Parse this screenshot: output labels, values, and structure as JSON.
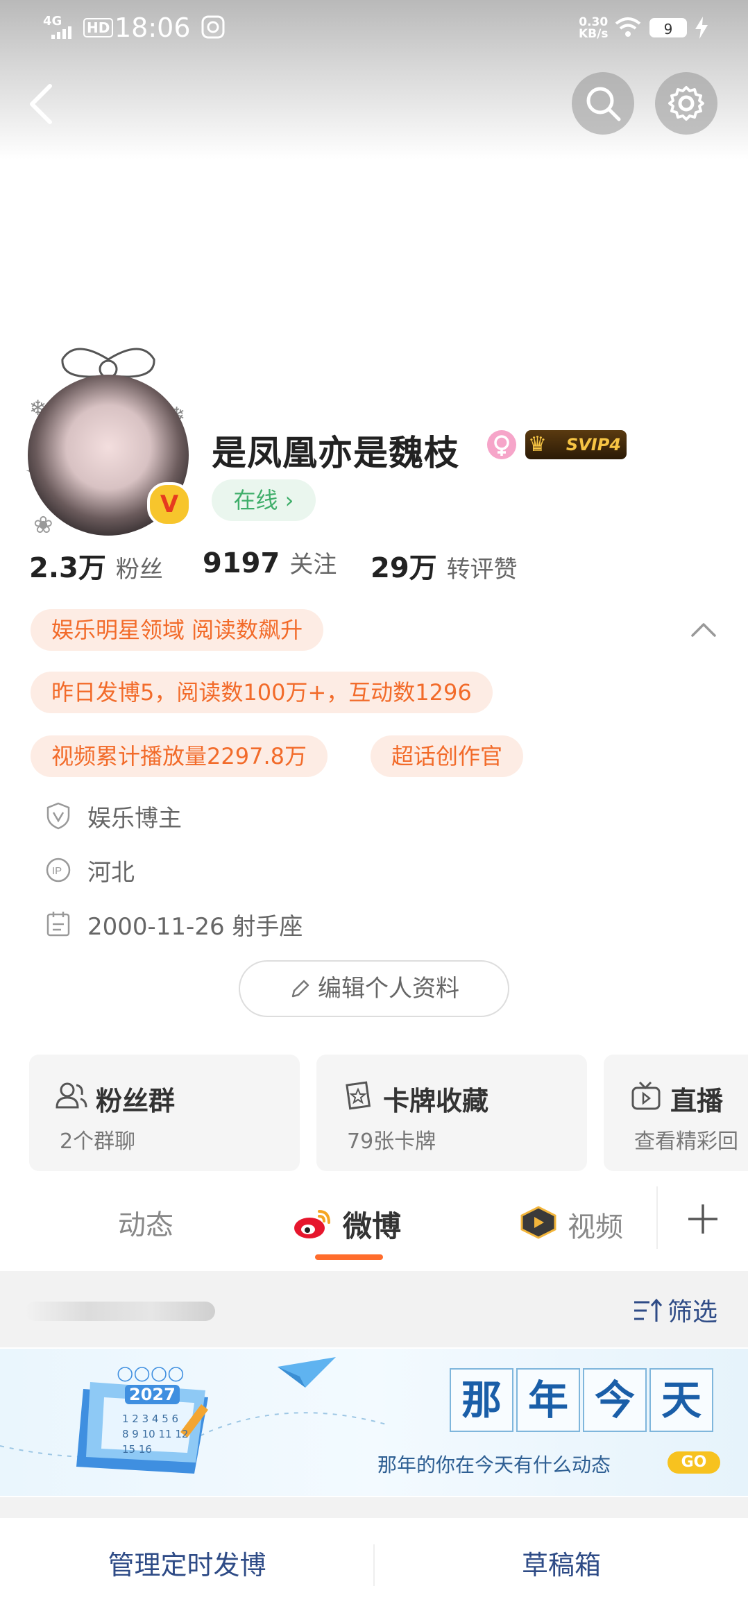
{
  "status_bar": {
    "signal": "4G",
    "hd": "HD",
    "time": "18:06",
    "net_speed_value": "0.30",
    "net_speed_unit": "KB/s",
    "battery": "9"
  },
  "profile": {
    "name": "是凤凰亦是魏枝",
    "verified_badge": "V",
    "vip_label": "SVIP4",
    "online_label": "在线 ›"
  },
  "stats": [
    {
      "value": "2.3万",
      "label": "粉丝"
    },
    {
      "value": "9197",
      "label": "关注"
    },
    {
      "value": "29万",
      "label": "转评赞"
    }
  ],
  "tags": {
    "tag1": "娱乐明星领域 阅读数飙升",
    "tag2": "昨日发博5，阅读数100万+，互动数1296",
    "tag3": "视频累计播放量2297.8万",
    "tag4": "超话创作官"
  },
  "info": {
    "category": "娱乐博主",
    "ip_location": "河北",
    "birthday": "2000-11-26 射手座"
  },
  "edit_button": "编辑个人资料",
  "cards": [
    {
      "title": "粉丝群",
      "sub": "2个群聊"
    },
    {
      "title": "卡牌收藏",
      "sub": "79张卡牌"
    },
    {
      "title": "直播",
      "sub": "查看精彩回"
    }
  ],
  "tabs": [
    "动态",
    "微博",
    "视频"
  ],
  "filter_label": "筛选",
  "banner": {
    "chars": [
      "那",
      "年",
      "今",
      "天"
    ],
    "subtitle": "那年的你在今天有什么动态",
    "go": "GO",
    "calendar_year": "2027",
    "calendar_nums": "1 2 3 4 5 6",
    "calendar_nums2": "8 9 10 11 12",
    "calendar_nums3": "15 16"
  },
  "bottom": {
    "left": "管理定时发博",
    "right": "草稿箱"
  },
  "colors": {
    "accent_orange": "#f26b2a",
    "tag_bg": "#fdece4",
    "online_green": "#3fae6a",
    "tab_underline": "#ff6c2c"
  }
}
